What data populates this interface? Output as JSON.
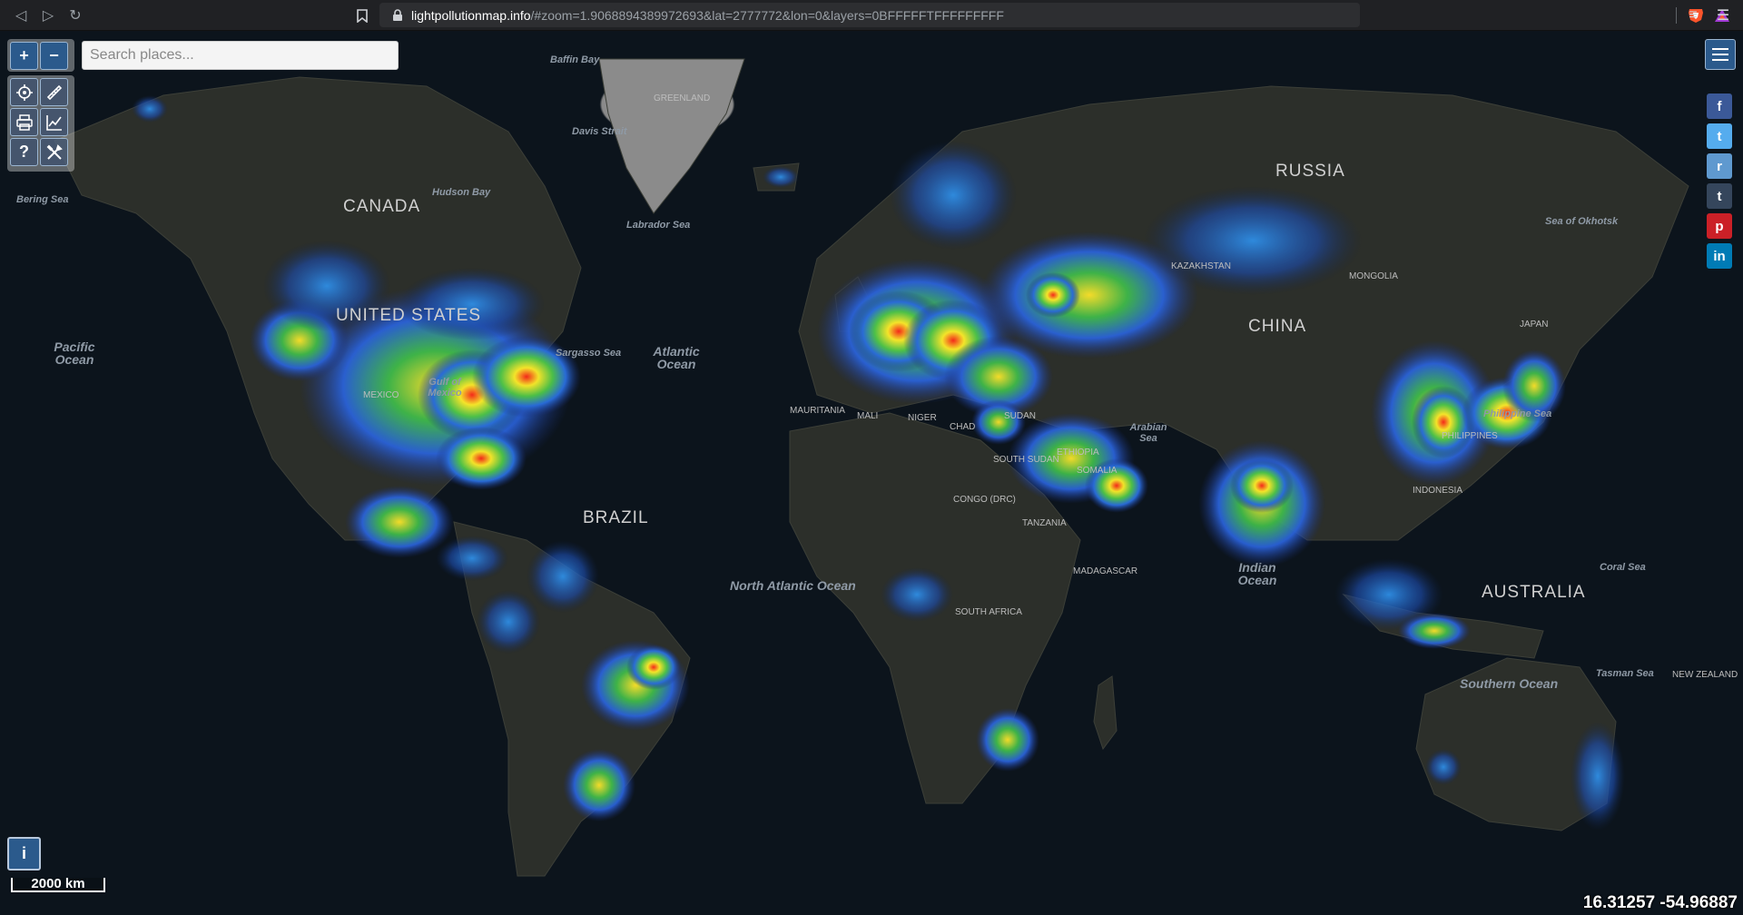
{
  "browser": {
    "url_domain": "lightpollutionmap.info",
    "url_path": "/#zoom=1.9068894389972693&lat=2777772&lon=0&layers=0BFFFFFTFFFFFFFFF"
  },
  "map": {
    "search_placeholder": "Search places...",
    "scale_label": "2000 km",
    "coordinates": "16.31257 -54.96887",
    "info_label": "i",
    "zoom_in": "+",
    "zoom_out": "−",
    "help_label": "?",
    "countries": {
      "canada": "CANADA",
      "united_states": "UNITED STATES",
      "brazil": "BRAZIL",
      "russia": "RUSSIA",
      "china": "CHINA",
      "australia": "AUSTRALIA"
    },
    "seas": {
      "baffin_bay": "Baffin Bay",
      "davis_strait": "Davis Strait",
      "hudson_bay": "Hudson Bay",
      "bering_sea": "Bering Sea",
      "labrador_sea": "Labrador Sea",
      "sargasso_sea": "Sargasso Sea",
      "gulf_of_mexico": "Gulf of Mexico",
      "arabian_sea": "Arabian Sea",
      "philippine_sea": "Philippine Sea",
      "coral_sea": "Coral Sea",
      "tasman_sea": "Tasman Sea",
      "sea_of_okhotsk": "Sea of Okhotsk"
    },
    "oceans": {
      "pacific": "Pacific Ocean",
      "atlantic": "Atlantic Ocean",
      "north_atlantic": "North Atlantic Ocean",
      "indian": "Indian Ocean",
      "southern": "Southern Ocean"
    },
    "small_labels": {
      "greenland": "GREENLAND",
      "mexico": "MEXICO",
      "kazakhstan": "KAZAKHSTAN",
      "mongolia": "MONGOLIA",
      "chad": "CHAD",
      "sudan": "SUDAN",
      "mali": "MALI",
      "niger": "NIGER",
      "ethiopia": "ETHIOPIA",
      "somalia": "SOMALIA",
      "congo": "CONGO (DRC)",
      "tanzania": "TANZANIA",
      "madagascar": "MADAGASCAR",
      "south_africa": "SOUTH AFRICA",
      "new_zealand": "NEW ZEALAND",
      "japan": "JAPAN",
      "philippines": "PHILIPPINES",
      "indonesia": "INDONESIA",
      "mauritania": "MAURITANIA",
      "south_sudan": "SOUTH SUDAN"
    }
  },
  "social": [
    {
      "name": "facebook",
      "glyph": "f",
      "color": "#3b5998"
    },
    {
      "name": "twitter",
      "glyph": "t",
      "color": "#55acee"
    },
    {
      "name": "reddit",
      "glyph": "r",
      "color": "#5f99cf"
    },
    {
      "name": "tumblr",
      "glyph": "t",
      "color": "#35465c"
    },
    {
      "name": "pinterest",
      "glyph": "p",
      "color": "#cb2027"
    },
    {
      "name": "linkedin",
      "glyph": "in",
      "color": "#007bb5"
    }
  ]
}
